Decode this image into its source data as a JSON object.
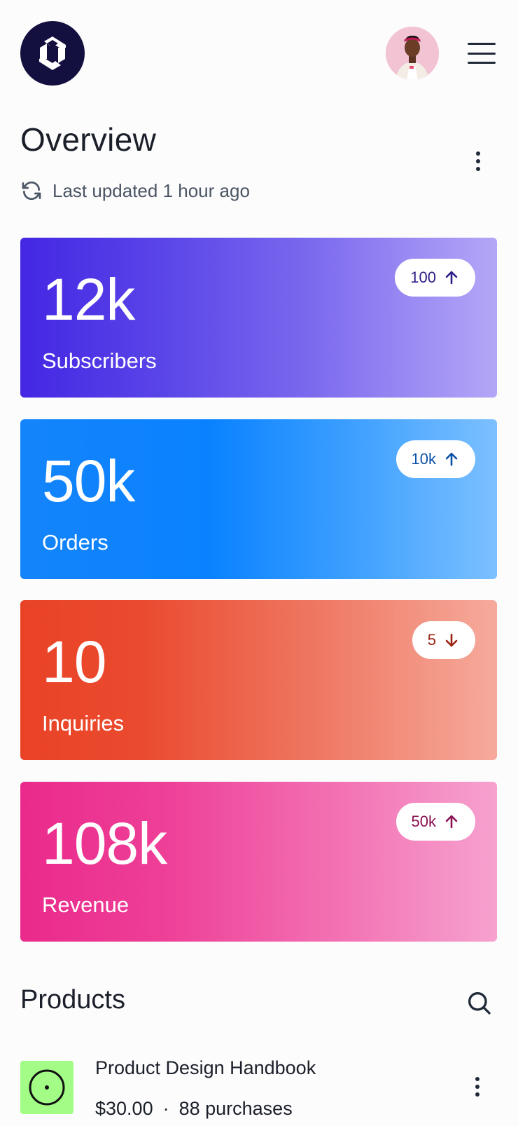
{
  "header": {
    "logo_icon": "brand-logo-icon",
    "avatar_icon": "user-avatar",
    "menu_icon": "hamburger-menu-icon"
  },
  "overview": {
    "title": "Overview",
    "updated_text": "Last updated 1 hour ago",
    "refresh_icon": "refresh-icon",
    "more_icon": "more-vertical-icon"
  },
  "stats": [
    {
      "value": "12k",
      "label": "Subscribers",
      "delta": "100",
      "trend": "up",
      "badge_color": "#2b1c86"
    },
    {
      "value": "50k",
      "label": "Orders",
      "delta": "10k",
      "trend": "up",
      "badge_color": "#0a4fa8"
    },
    {
      "value": "10",
      "label": "Inquiries",
      "delta": "5",
      "trend": "down",
      "badge_color": "#9a2010"
    },
    {
      "value": "108k",
      "label": "Revenue",
      "delta": "50k",
      "trend": "up",
      "badge_color": "#8a1152"
    }
  ],
  "products": {
    "title": "Products",
    "search_icon": "search-icon",
    "items": [
      {
        "name": "Product Design Handbook",
        "price": "$30.00",
        "separator": "·",
        "purchases": "88 purchases",
        "thumb_color": "#a3fc86"
      }
    ]
  }
}
